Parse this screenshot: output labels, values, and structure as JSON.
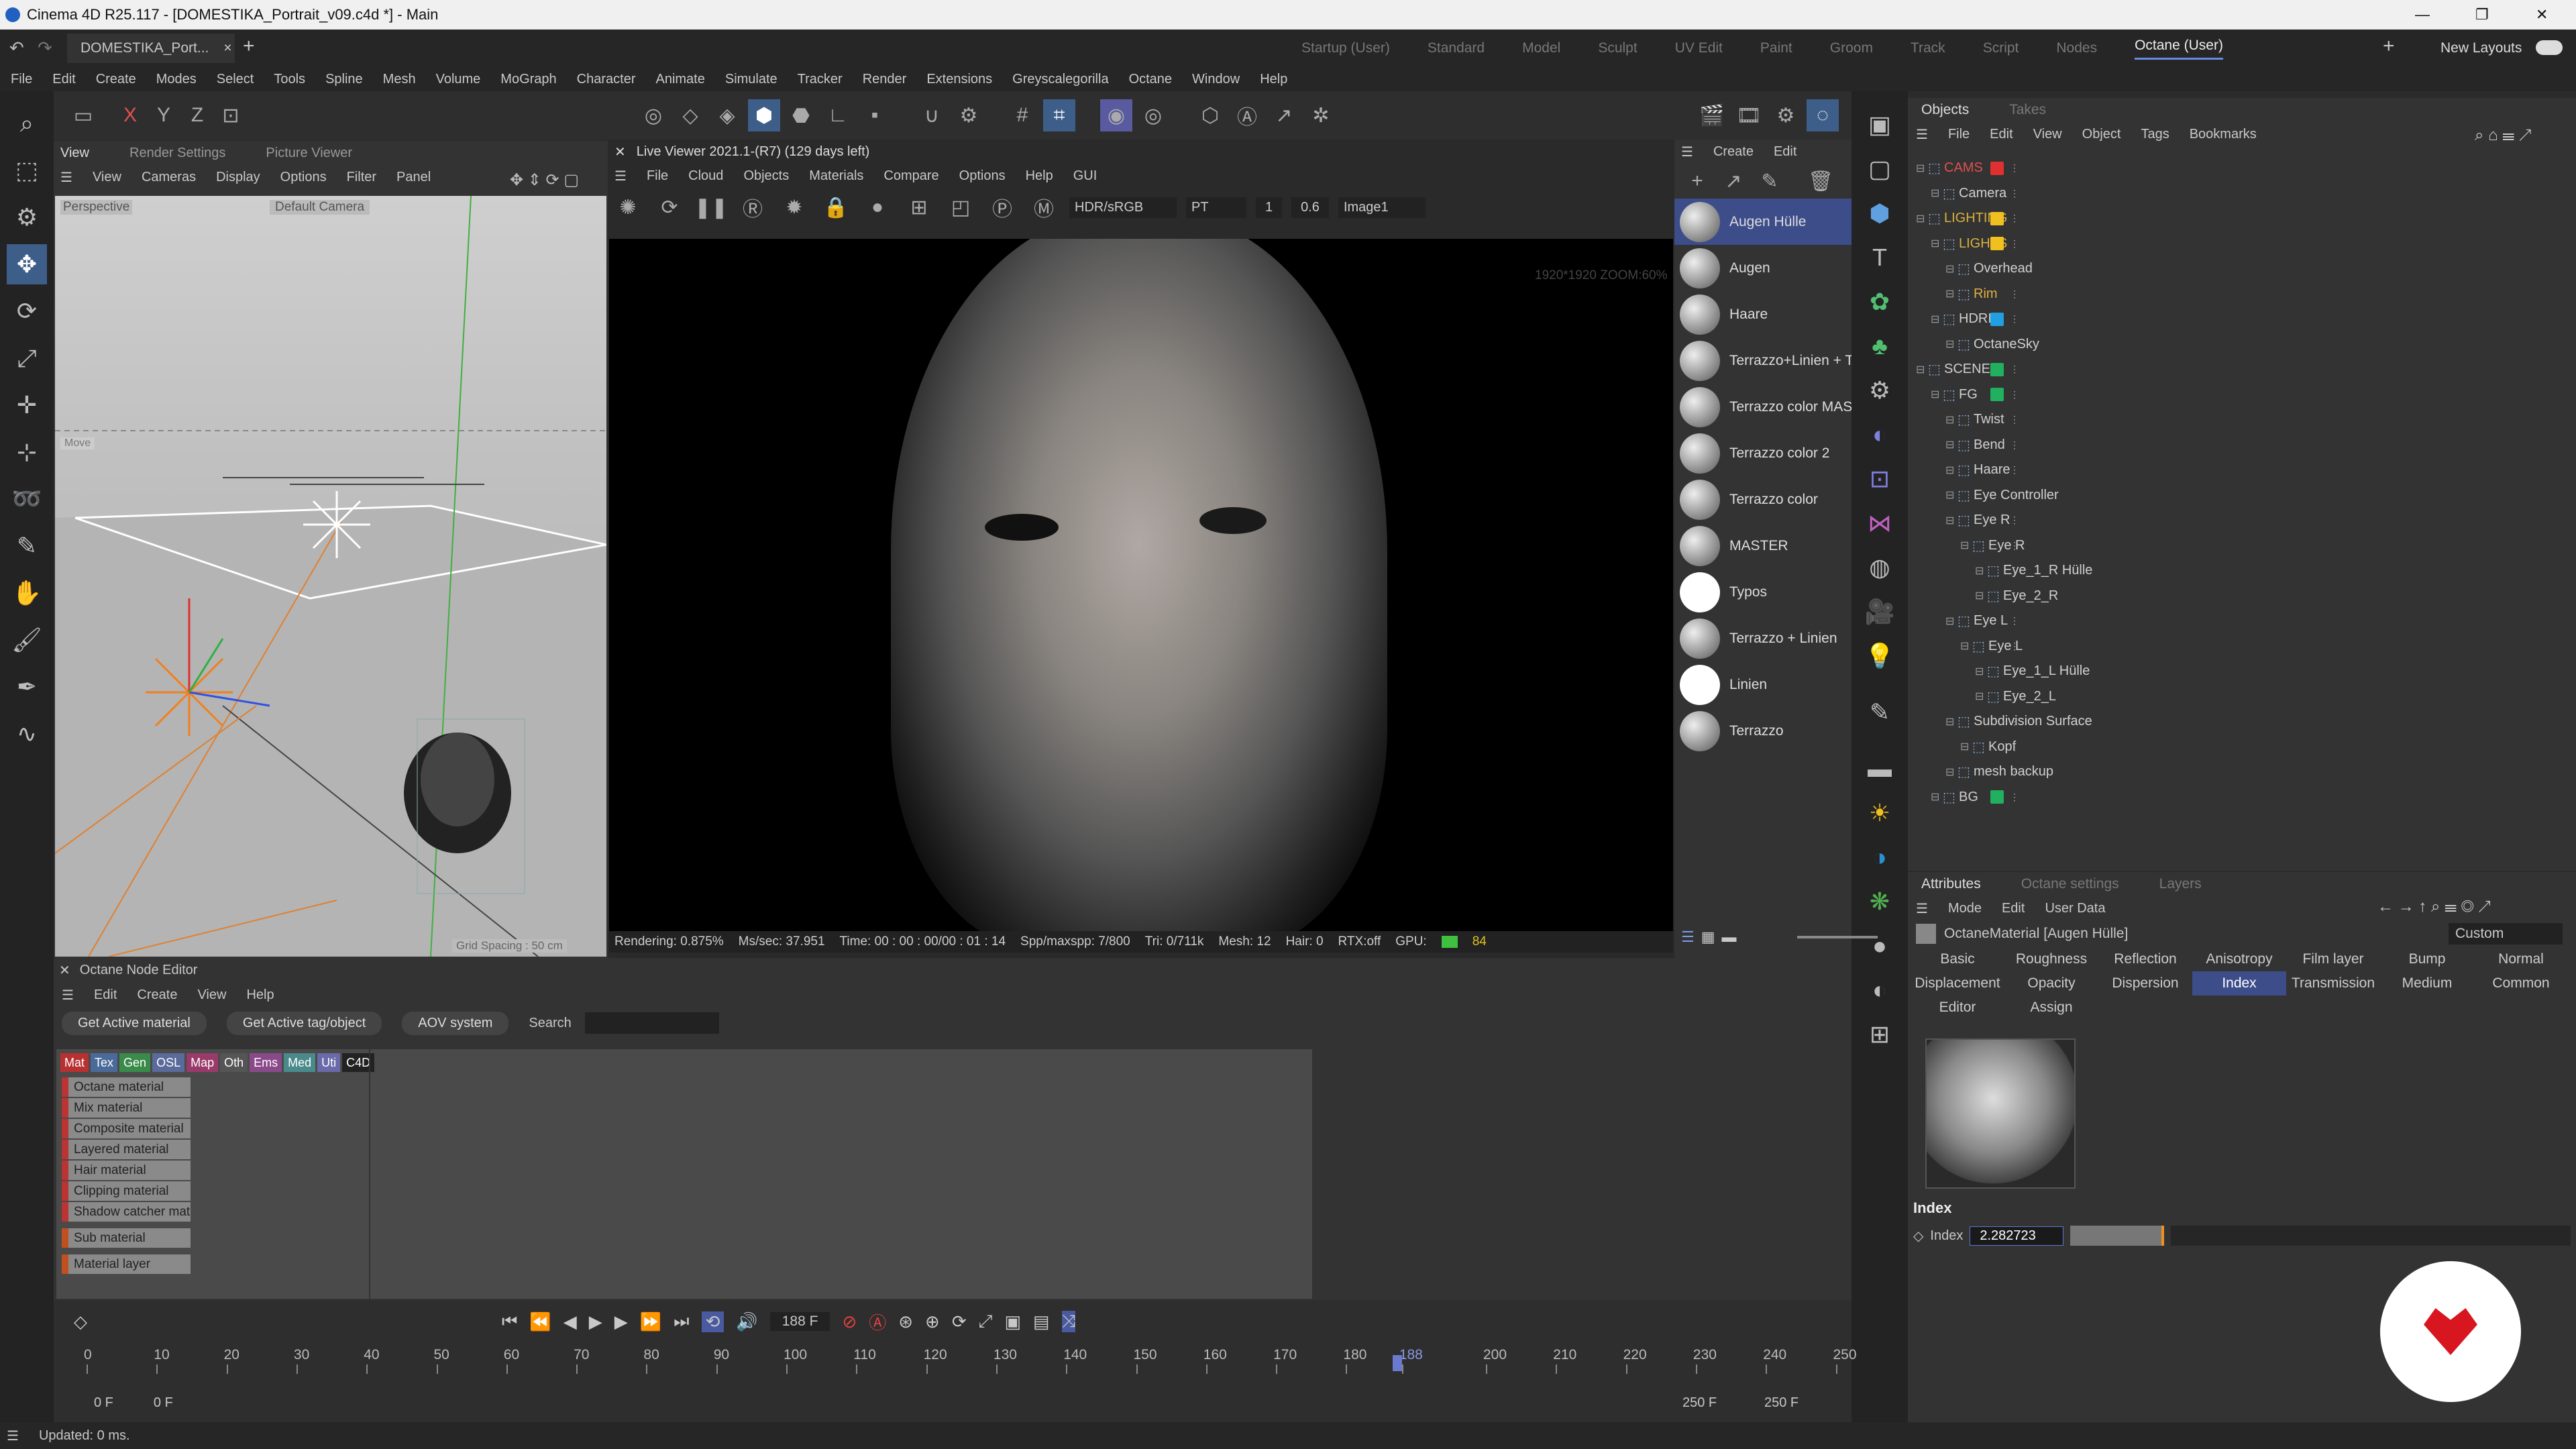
{
  "window": {
    "title": "Cinema 4D R25.117 - [DOMESTIKA_Portrait_v09.c4d *] - Main",
    "tab": "DOMESTIKA_Port...",
    "minimize": "—",
    "maximize": "❐",
    "close": "✕"
  },
  "layouts": [
    "Startup (User)",
    "Standard",
    "Model",
    "Sculpt",
    "UV Edit",
    "Paint",
    "Groom",
    "Track",
    "Script",
    "Nodes",
    "Octane (User)"
  ],
  "new_layouts": "New Layouts",
  "menu": [
    "File",
    "Edit",
    "Create",
    "Modes",
    "Select",
    "Tools",
    "Spline",
    "Mesh",
    "Volume",
    "MoGraph",
    "Character",
    "Animate",
    "Simulate",
    "Tracker",
    "Render",
    "Extensions",
    "Greyscalegorilla",
    "Octane",
    "Window",
    "Help"
  ],
  "viewport": {
    "tabs": [
      "View",
      "Render Settings",
      "Picture Viewer"
    ],
    "menu": [
      "View",
      "Cameras",
      "Display",
      "Options",
      "Filter",
      "Panel"
    ],
    "label": "Perspective",
    "camera": "Default Camera",
    "move": "Move",
    "grid": "Grid Spacing : 50 cm"
  },
  "live_viewer": {
    "title": "Live Viewer 2021.1-(R7) (129 days left)",
    "menu": [
      "File",
      "Cloud",
      "Objects",
      "Materials",
      "Compare",
      "Options",
      "Help",
      "GUI"
    ],
    "colorspace": "HDR/sRGB",
    "mode": "PT",
    "val1": "1",
    "val2": "0.6",
    "image": "Image1",
    "zoom": "1920*1920 ZOOM:60%",
    "status": {
      "rendering": "Rendering: 0.875%",
      "ms": "Ms/sec: 37.951",
      "time": "Time: 00 : 00 : 00/00 : 01 : 14",
      "spp": "Spp/maxspp: 7/800",
      "tri": "Tri: 0/711k",
      "mesh": "Mesh: 12",
      "hair": "Hair: 0",
      "rtx": "RTX:off",
      "gpu": "GPU:",
      "gpu_val": "84"
    }
  },
  "materials": {
    "menu": [
      "Create",
      "Edit"
    ],
    "items": [
      "Augen Hülle",
      "Augen",
      "Haare",
      "Terrazzo+Linien + T",
      "Terrazzo color MAS",
      "Terrazzo color 2",
      "Terrazzo color",
      "MASTER",
      "Typos",
      "Terrazzo + Linien",
      "Linien",
      "Terrazzo"
    ]
  },
  "objects": {
    "tabs": [
      "Objects",
      "Takes"
    ],
    "menu": [
      "File",
      "Edit",
      "View",
      "Object",
      "Tags",
      "Bookmarks"
    ],
    "tree": [
      {
        "name": "CAMS",
        "indent": 0,
        "color": "#e03030",
        "text_color": "#e05050"
      },
      {
        "name": "Camera",
        "indent": 1,
        "color": "",
        "text_color": "#d0d0d0"
      },
      {
        "name": "LIGHTING",
        "indent": 0,
        "color": "#f0c020",
        "text_color": "#d8b040"
      },
      {
        "name": "LIGHTS",
        "indent": 1,
        "color": "#f0c020",
        "text_color": "#d8b040"
      },
      {
        "name": "Overhead",
        "indent": 2,
        "color": "",
        "text_color": "#d0d0d0"
      },
      {
        "name": "Rim",
        "indent": 2,
        "color": "",
        "text_color": "#e0b040"
      },
      {
        "name": "HDRI",
        "indent": 1,
        "color": "#20a0e0",
        "text_color": "#d0d0d0"
      },
      {
        "name": "OctaneSky",
        "indent": 2,
        "color": "",
        "text_color": "#d0d0d0"
      },
      {
        "name": "SCENE",
        "indent": 0,
        "color": "#20b060",
        "text_color": "#d0d0d0"
      },
      {
        "name": "FG",
        "indent": 1,
        "color": "#20b060",
        "text_color": "#d0d0d0"
      },
      {
        "name": "Twist",
        "indent": 2,
        "color": "",
        "text_color": "#d0d0d0"
      },
      {
        "name": "Bend",
        "indent": 2,
        "color": "",
        "text_color": "#d0d0d0"
      },
      {
        "name": "Haare",
        "indent": 2,
        "color": "",
        "text_color": "#d0d0d0"
      },
      {
        "name": "Eye Controller",
        "indent": 2,
        "color": "",
        "text_color": "#d0d0d0"
      },
      {
        "name": "Eye R",
        "indent": 2,
        "color": "",
        "text_color": "#d0d0d0"
      },
      {
        "name": "Eye R",
        "indent": 3,
        "color": "",
        "text_color": "#d0d0d0"
      },
      {
        "name": "Eye_1_R Hülle",
        "indent": 4,
        "color": "",
        "text_color": "#d0d0d0"
      },
      {
        "name": "Eye_2_R",
        "indent": 4,
        "color": "",
        "text_color": "#d0d0d0"
      },
      {
        "name": "Eye L",
        "indent": 2,
        "color": "",
        "text_color": "#d0d0d0"
      },
      {
        "name": "Eye L",
        "indent": 3,
        "color": "",
        "text_color": "#d0d0d0"
      },
      {
        "name": "Eye_1_L Hülle",
        "indent": 4,
        "color": "",
        "text_color": "#d0d0d0"
      },
      {
        "name": "Eye_2_L",
        "indent": 4,
        "color": "",
        "text_color": "#d0d0d0"
      },
      {
        "name": "Subdivision Surface",
        "indent": 2,
        "color": "",
        "text_color": "#d0d0d0"
      },
      {
        "name": "Kopf",
        "indent": 3,
        "color": "",
        "text_color": "#d0d0d0"
      },
      {
        "name": "mesh backup",
        "indent": 2,
        "color": "",
        "text_color": "#d0d0d0"
      },
      {
        "name": "BG",
        "indent": 1,
        "color": "#20b060",
        "text_color": "#d0d0d0"
      }
    ]
  },
  "attributes": {
    "tabs": [
      "Attributes",
      "Octane settings",
      "Layers"
    ],
    "menu": [
      "Mode",
      "Edit",
      "User Data"
    ],
    "material": "OctaneMaterial [Augen Hülle]",
    "preset": "Custom",
    "chan_row1": [
      "Basic",
      "Roughness",
      "Reflection",
      "Anisotropy",
      "Film layer",
      "Bump",
      "Normal"
    ],
    "chan_row2": [
      "Displacement",
      "Opacity",
      "Dispersion",
      "Index",
      "Transmission",
      "Medium",
      "Common"
    ],
    "chan_row3": [
      "Editor",
      "Assign"
    ],
    "section": "Index",
    "index_label": "Index",
    "index_value": "2.282723"
  },
  "node_editor": {
    "title": "Octane Node Editor",
    "menu": [
      "Edit",
      "Create",
      "View",
      "Help"
    ],
    "buttons": [
      "Get Active material",
      "Get Active tag/object",
      "AOV system"
    ],
    "search_label": "Search",
    "categories": [
      {
        "n": "Mat",
        "c": "#b83030"
      },
      {
        "n": "Tex",
        "c": "#4a6a9a"
      },
      {
        "n": "Gen",
        "c": "#3a8a4a"
      },
      {
        "n": "OSL",
        "c": "#5a6a9a"
      },
      {
        "n": "Map",
        "c": "#9a3a6a"
      },
      {
        "n": "Oth",
        "c": "#555555"
      },
      {
        "n": "Ems",
        "c": "#8a4a8a"
      },
      {
        "n": "Med",
        "c": "#4a8a8a"
      },
      {
        "n": "Uti",
        "c": "#6a6aaa"
      },
      {
        "n": "C4D",
        "c": "#222222"
      }
    ],
    "items": [
      "Octane material",
      "Mix material",
      "Composite material",
      "Layered material",
      "Hair material",
      "Clipping material",
      "Shadow catcher mat",
      "Sub material",
      "Material layer"
    ]
  },
  "timeline": {
    "frame": "188 F",
    "ticks": [
      "0",
      "10",
      "20",
      "30",
      "40",
      "50",
      "60",
      "70",
      "80",
      "90",
      "100",
      "110",
      "120",
      "130",
      "140",
      "150",
      "160",
      "170",
      "180",
      "188",
      "200",
      "210",
      "220",
      "230",
      "240",
      "250"
    ],
    "start": "0 F",
    "start2": "0 F",
    "end": "250 F",
    "end2": "250 F"
  },
  "status_bar": "Updated: 0 ms."
}
